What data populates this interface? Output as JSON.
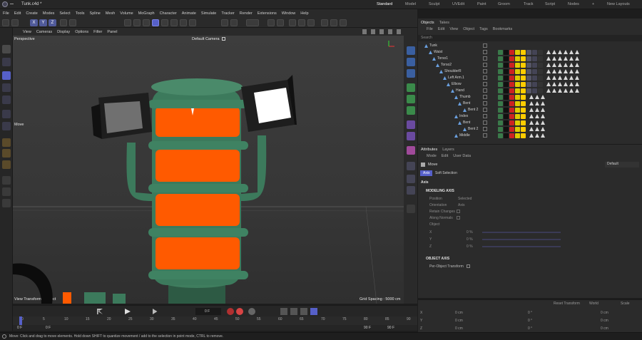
{
  "window": {
    "title": "Tunk.c4d *"
  },
  "layouts": [
    "Standard",
    "Model",
    "Sculpt",
    "UVEdit",
    "Paint",
    "Groom",
    "Track",
    "Script",
    "Nodes",
    "+",
    "New Layouts"
  ],
  "menu": [
    "File",
    "Edit",
    "Create",
    "Modes",
    "Select",
    "Tools",
    "Spline",
    "Mesh",
    "Volume",
    "MoGraph",
    "Character",
    "Animate",
    "Simulate",
    "Tracker",
    "Render",
    "Extensions",
    "Window",
    "Help"
  ],
  "axis_buttons": [
    "X",
    "Y",
    "Z"
  ],
  "viewport_menu": [
    "View",
    "Cameras",
    "Display",
    "Options",
    "Filter",
    "Panel"
  ],
  "viewport": {
    "name": "Perspective",
    "camera": "Default Camera",
    "camera_icon": "camera-icon",
    "tool": "Move",
    "bottom_left": "View Transform: Project",
    "grid": "Grid Spacing : 5000 cm"
  },
  "timeline": {
    "current": "0 F",
    "ticks": [
      "0",
      "5",
      "10",
      "15",
      "20",
      "25",
      "30",
      "35",
      "40",
      "45",
      "50",
      "55",
      "60",
      "65",
      "70",
      "75",
      "80",
      "85",
      "90"
    ],
    "start": "0 F",
    "start2": "0 F",
    "end": "90 F",
    "end2": "90 F"
  },
  "status": "Move: Click and drag to move elements. Hold down SHIFT to quantize movement / add to the selection in point mode, CTRL to remove.",
  "objects": {
    "tabs": [
      "Objects",
      "Takes"
    ],
    "menu": [
      "File",
      "Edit",
      "View",
      "Object",
      "Tags",
      "Bookmarks"
    ],
    "search": "Search",
    "rows": [
      {
        "name": "Tunk"
      },
      {
        "name": "Waist"
      },
      {
        "name": "Torso1"
      },
      {
        "name": "Torso2"
      },
      {
        "name": "ShoulderR"
      },
      {
        "name": "Left Arm.1"
      },
      {
        "name": "Elbow"
      },
      {
        "name": "Hand"
      },
      {
        "name": "Thumb"
      },
      {
        "name": "Bent"
      },
      {
        "name": "Bent 2"
      },
      {
        "name": "Index"
      },
      {
        "name": "Bent"
      },
      {
        "name": "Bent 2"
      },
      {
        "name": "Middle"
      }
    ]
  },
  "attributes": {
    "tabs": [
      "Attributes",
      "Layers"
    ],
    "menu": [
      "Mode",
      "Edit",
      "User Data"
    ],
    "tool": "Move",
    "preset": "Default",
    "subtabs": [
      "Axis",
      "Soft Selection"
    ],
    "section": "Axis",
    "modeling_axis": {
      "title": "MODELING AXIS",
      "position_label": "Position",
      "position": "Selected",
      "orientation_label": "Orientation",
      "orientation": "Axis",
      "retain": "Retain Changes",
      "along": "Along Normals",
      "object": "Object",
      "x": "X",
      "x_val": "0 %",
      "y": "Y",
      "y_val": "0 %",
      "z": "Z",
      "z_val": "0 %"
    },
    "object_axis": {
      "title": "OBJECT AXIS",
      "per": "Per-Object Transform"
    }
  },
  "coordinates": {
    "reset": "Reset Transform",
    "space": "World",
    "scale": "Scale",
    "rows": [
      {
        "axis": "X",
        "pos": "0 cm",
        "rot": "0 °",
        "scale": "0 cm"
      },
      {
        "axis": "Y",
        "pos": "0 cm",
        "rot": "0 °",
        "scale": "0 cm"
      },
      {
        "axis": "Z",
        "pos": "0 cm",
        "rot": "0 °",
        "scale": "0 cm"
      }
    ]
  },
  "colors": {
    "accent": "#5660c9",
    "robot_green": "#3c7a5c",
    "robot_orange": "#ff5a00"
  }
}
